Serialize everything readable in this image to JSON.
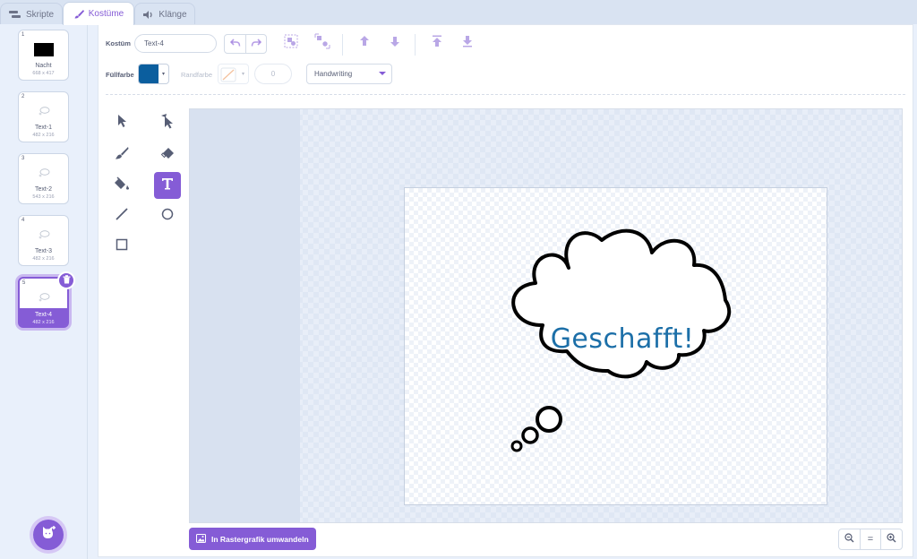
{
  "tabs": [
    {
      "label": "Skripte",
      "icon": "code-icon"
    },
    {
      "label": "Kostüme",
      "icon": "brush-icon",
      "active": true
    },
    {
      "label": "Klänge",
      "icon": "speaker-icon"
    }
  ],
  "costumes": [
    {
      "number": "1",
      "name": "Nacht",
      "size": "668 x 417",
      "thumb": "black-rectangle"
    },
    {
      "number": "2",
      "name": "Text-1",
      "size": "482 x 216",
      "thumb": "speech-bubble"
    },
    {
      "number": "3",
      "name": "Text-2",
      "size": "543 x 216",
      "thumb": "speech-bubble"
    },
    {
      "number": "4",
      "name": "Text-3",
      "size": "482 x 216",
      "thumb": "speech-bubble"
    },
    {
      "number": "5",
      "name": "Text-4",
      "size": "482 x 216",
      "thumb": "speech-bubble",
      "selected": true
    }
  ],
  "toolbar": {
    "costume_label": "Kostüm",
    "costume_name": "Text-4",
    "fill_label": "Füllfarbe",
    "fill_color": "#0b5e9e",
    "stroke_label": "Randfarbe",
    "stroke_width": "0",
    "font": "Handwriting"
  },
  "canvas": {
    "text": "Geschafft!"
  },
  "bottom": {
    "convert_label": "In Rastergrafik umwandeln",
    "zoom_reset_label": "="
  },
  "colors": {
    "accent": "#855cd6",
    "text_color": "#1c6fa8"
  }
}
